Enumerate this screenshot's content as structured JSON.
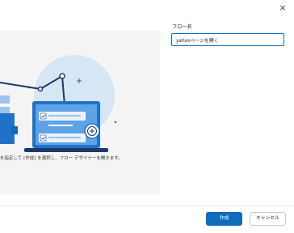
{
  "dialog": {
    "close_glyph": "×",
    "close_icon": "close-icon"
  },
  "preview": {
    "caption": "を指定して [作成] を選択し、フロー デザイナーを開きます。",
    "illustration_icons": [
      "laptop-icon",
      "checklist-icon",
      "plus-icon",
      "robot-arm-icon"
    ]
  },
  "form": {
    "flow_name_label": "フロー名",
    "flow_name_value": "yahooページを開く"
  },
  "footer": {
    "create_label": "作成",
    "cancel_label": "キャンセル"
  },
  "colors": {
    "primary": "#0f6cbd",
    "illustration_circle": "#d6e6f5",
    "panel_background": "#f4f4f4"
  }
}
